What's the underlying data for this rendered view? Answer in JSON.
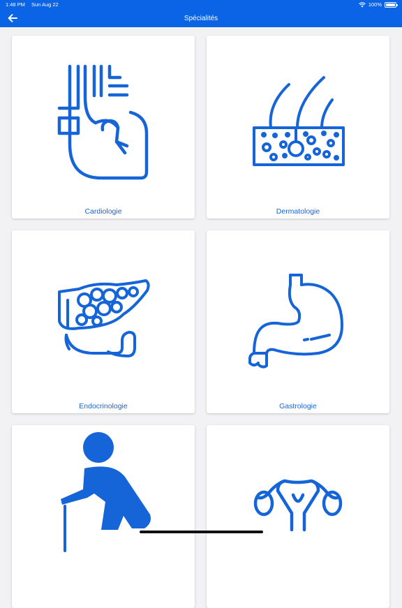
{
  "status_bar": {
    "time": "1:48 PM",
    "date": "Sun Aug 22",
    "battery": "100%",
    "icons": [
      "wifi-icon",
      "battery-icon"
    ]
  },
  "nav": {
    "title": "Spécialités",
    "back_icon": "arrow-left-icon"
  },
  "colors": {
    "primary": "#0b63e5",
    "background": "#f2f2f4",
    "card": "#ffffff",
    "icon": "#1565d8"
  },
  "specialties": [
    {
      "label": "Cardiologie",
      "icon": "heart-icon"
    },
    {
      "label": "Dermatologie",
      "icon": "skin-icon"
    },
    {
      "label": "Endocrinologie",
      "icon": "pancreas-icon"
    },
    {
      "label": "Gastrologie",
      "icon": "stomach-icon"
    },
    {
      "label": "",
      "icon": "elderly-person-icon"
    },
    {
      "label": "",
      "icon": "uterus-icon"
    }
  ]
}
